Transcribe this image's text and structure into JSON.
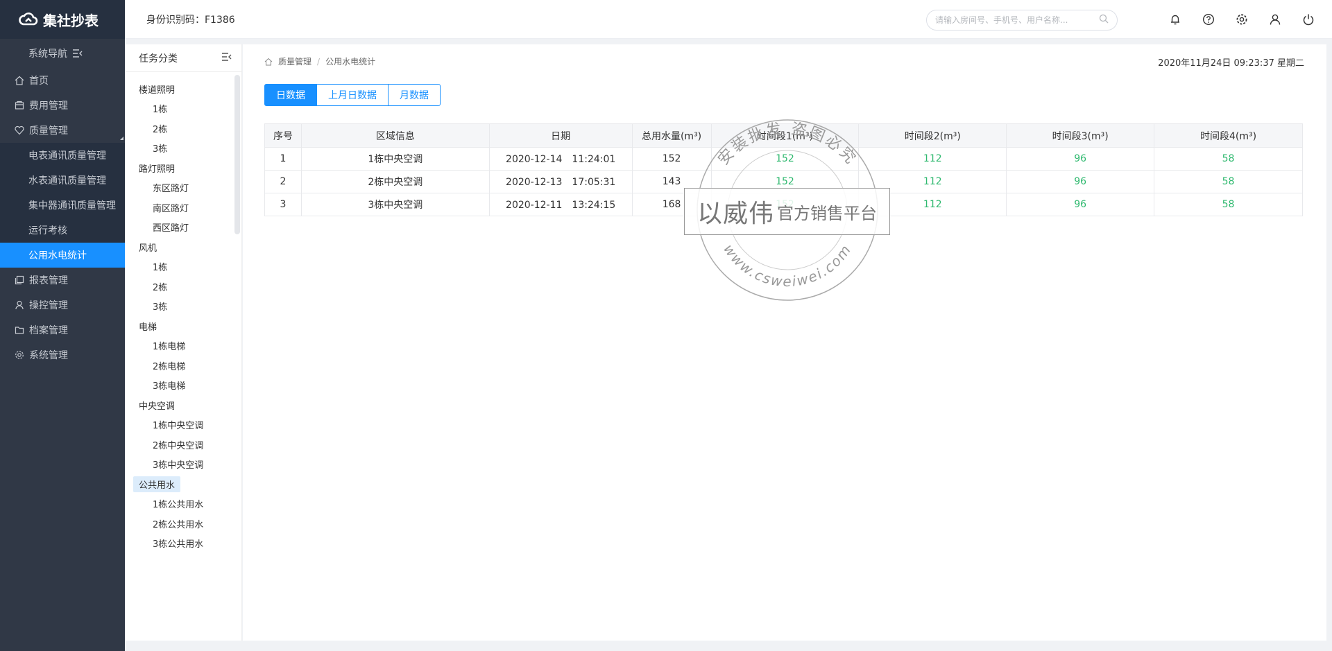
{
  "app": {
    "logo_text": "集社抄表"
  },
  "header": {
    "id_label": "身份识别码：F1386",
    "search_placeholder": "请输入房间号、手机号、用户名称..."
  },
  "sidebar": {
    "nav_title": "系统导航",
    "items": [
      {
        "label": "首页",
        "icon": "home-icon"
      },
      {
        "label": "费用管理",
        "icon": "fee-icon"
      },
      {
        "label": "质量管理",
        "icon": "quality-icon"
      }
    ],
    "sub_items": [
      {
        "label": "电表通讯质量管理"
      },
      {
        "label": "水表通讯质量管理"
      },
      {
        "label": "集中器通讯质量管理"
      },
      {
        "label": "运行考核"
      },
      {
        "label": "公用水电统计"
      }
    ],
    "items_after": [
      {
        "label": "报表管理",
        "icon": "report-icon"
      },
      {
        "label": "操控管理",
        "icon": "control-icon"
      },
      {
        "label": "档案管理",
        "icon": "archive-icon"
      },
      {
        "label": "系统管理",
        "icon": "settings-icon"
      }
    ]
  },
  "task_panel": {
    "title": "任务分类",
    "tree": [
      {
        "type": "group",
        "label": "楼道照明"
      },
      {
        "type": "leaf",
        "label": "1栋"
      },
      {
        "type": "leaf",
        "label": "2栋"
      },
      {
        "type": "leaf",
        "label": "3栋"
      },
      {
        "type": "group",
        "label": "路灯照明"
      },
      {
        "type": "leaf",
        "label": "东区路灯"
      },
      {
        "type": "leaf",
        "label": "南区路灯"
      },
      {
        "type": "leaf",
        "label": "西区路灯"
      },
      {
        "type": "group",
        "label": "风机"
      },
      {
        "type": "leaf",
        "label": "1栋"
      },
      {
        "type": "leaf",
        "label": "2栋"
      },
      {
        "type": "leaf",
        "label": "3栋"
      },
      {
        "type": "group",
        "label": "电梯"
      },
      {
        "type": "leaf",
        "label": "1栋电梯"
      },
      {
        "type": "leaf",
        "label": "2栋电梯"
      },
      {
        "type": "leaf",
        "label": "3栋电梯"
      },
      {
        "type": "group",
        "label": "中央空调"
      },
      {
        "type": "leaf",
        "label": "1栋中央空调"
      },
      {
        "type": "leaf",
        "label": "2栋中央空调"
      },
      {
        "type": "leaf",
        "label": "3栋中央空调"
      },
      {
        "type": "group",
        "label": "公共用水",
        "selected": true
      },
      {
        "type": "leaf",
        "label": "1栋公共用水"
      },
      {
        "type": "leaf",
        "label": "2栋公共用水"
      },
      {
        "type": "leaf",
        "label": "3栋公共用水"
      }
    ]
  },
  "content": {
    "breadcrumb": [
      "质量管理",
      "公用水电统计"
    ],
    "datetime": "2020年11月24日 09:23:37 星期二",
    "tabs": [
      {
        "label": "日数据",
        "active": true
      },
      {
        "label": "上月日数据",
        "active": false
      },
      {
        "label": "月数据",
        "active": false
      }
    ],
    "table": {
      "headers": [
        "序号",
        "区域信息",
        "日期",
        "总用水量(m³)",
        "时间段1(m³)",
        "时间段2(m³)",
        "时间段3(m³)",
        "时间段4(m³)"
      ],
      "rows": [
        [
          "1",
          "1栋中央空调",
          "2020-12-14　11:24:01",
          "152",
          "152",
          "112",
          "96",
          "58"
        ],
        [
          "2",
          "2栋中央空调",
          "2020-12-13　17:05:31",
          "143",
          "152",
          "112",
          "96",
          "58"
        ],
        [
          "3",
          "3栋中央空调",
          "2020-12-11　13:24:15",
          "168",
          "152",
          "112",
          "96",
          "58"
        ]
      ]
    }
  },
  "watermark": {
    "top_arc": "安装批发 盗图必究",
    "brand_big": "以威伟",
    "brand_small": "官方销售平台",
    "bottom_arc": "www.csweiwei.com"
  },
  "colors": {
    "sidebar_bg": "#303846",
    "accent": "#1890ff",
    "value_green": "#2fb96f"
  }
}
